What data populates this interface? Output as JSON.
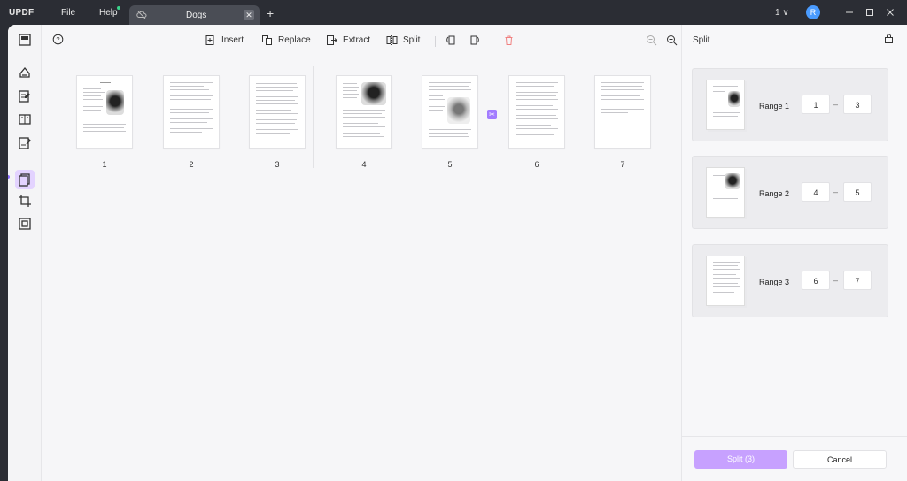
{
  "titlebar": {
    "logo": "UPDF",
    "menu": [
      "File",
      "Help"
    ],
    "tab_title": "Dogs",
    "page_indicator": "1 ∨",
    "user_initial": "R"
  },
  "toolbar": {
    "insert": "Insert",
    "replace": "Replace",
    "extract": "Extract",
    "split": "Split"
  },
  "pages": [
    {
      "number": "1"
    },
    {
      "number": "2"
    },
    {
      "number": "3"
    },
    {
      "number": "4"
    },
    {
      "number": "5"
    },
    {
      "number": "6"
    },
    {
      "number": "7"
    }
  ],
  "panel": {
    "title": "Split",
    "ranges": [
      {
        "label": "Range 1",
        "from": "1",
        "to": "3"
      },
      {
        "label": "Range 2",
        "from": "4",
        "to": "5"
      },
      {
        "label": "Range 3",
        "from": "6",
        "to": "7"
      }
    ],
    "split_button": "Split (3)",
    "cancel_button": "Cancel"
  },
  "colors": {
    "accent": "#a37cff",
    "split_button_bg": "#c7a1ff",
    "titlebar_bg": "#2b2d34"
  }
}
